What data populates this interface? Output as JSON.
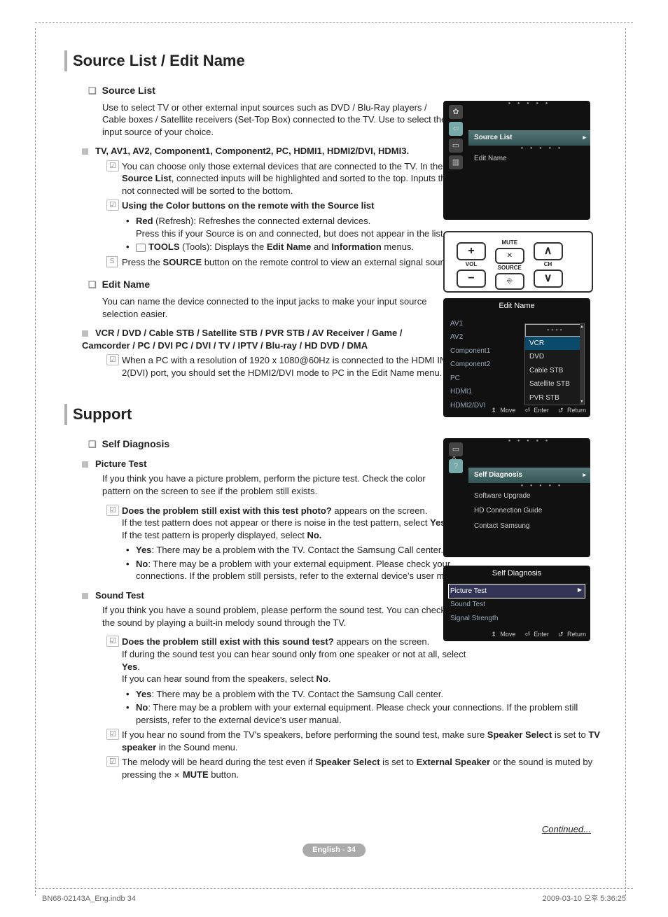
{
  "section1": {
    "title": "Source List / Edit Name",
    "source_list": {
      "heading": "Source List",
      "intro": "Use to select TV or other external input sources such as DVD / Blu-Ray players / Cable boxes / Satellite receivers (Set-Top Box) connected to the TV. Use to select the input source of your choice.",
      "inputs_heading": "TV, AV1, AV2, Component1, Component2, PC, HDMI1, HDMI2/DVI, HDMI3.",
      "note1_a": "You can choose only those external devices that are connected to the TV. In the ",
      "note1_b": "Source List",
      "note1_c": ", connected inputs will be highlighted and sorted to the top. Inputs that are not connected will be sorted to the bottom.",
      "note2_title": "Using the Color buttons on the remote with the Source list",
      "bullet_red_a": "Red",
      "bullet_red_b": " (Refresh): Refreshes the connected external devices.",
      "bullet_red_c": "Press this if your Source is on and connected, but does not appear in the list.",
      "bullet_tools_a": "TOOLS",
      "bullet_tools_b": " (Tools): Displays the ",
      "bullet_tools_c": "Edit Name",
      "bullet_tools_d": " and ",
      "bullet_tools_e": "Information",
      "bullet_tools_f": " menus.",
      "source_btn_a": "Press the ",
      "source_btn_b": "SOURCE",
      "source_btn_c": " button on the remote control to view an external signal source."
    },
    "edit_name": {
      "heading": "Edit Name",
      "intro": "You can name the device connected to the input jacks to make your input source selection easier.",
      "devices": "VCR / DVD / Cable STB / Satellite STB / PVR STB / AV Receiver / Game / Camcorder / PC / DVI PC / DVI / TV / IPTV / Blu-ray / HD DVD / DMA",
      "note": "When a PC with a resolution of 1920 x 1080@60Hz is connected to the HDMI IN 2(DVI) port, you should set the HDMI2/DVI mode to PC in the Edit Name menu."
    }
  },
  "section2": {
    "title": "Support",
    "self_diag": {
      "heading": "Self Diagnosis",
      "picture": {
        "h": "Picture Test",
        "intro": "If you think you have a picture problem, perform the picture test. Check the color pattern on the screen to see if the problem still exists.",
        "q_a": "Does the problem still exist with this test photo?",
        "q_b": " appears on the screen.",
        "line1_a": "If the test pattern does not appear or there is noise in the test pattern, select ",
        "line1_b": "Yes.",
        "line2_a": "If the test pattern is properly displayed, select ",
        "line2_b": "No.",
        "yes_a": "Yes",
        "yes_b": ": There may be a problem with the TV. Contact the Samsung Call center.",
        "no_a": "No",
        "no_b": ": There may be a problem with your external equipment. Please check your connections. If the problem still persists, refer to the external device's user manual."
      },
      "sound": {
        "h": "Sound Test",
        "intro": "If you think you have a sound problem, please perform the sound test. You can check the sound by playing a built-in melody sound through the TV.",
        "q_a": "Does the problem still exist with this sound test?",
        "q_b": " appears on the screen.",
        "line1_a": "If during the sound test you can hear sound only from one speaker or not at all, select ",
        "line1_b": "Yes",
        "line1_c": ".",
        "line2_a": "If you can hear sound from the speakers, select ",
        "line2_b": "No",
        "line2_c": ".",
        "yes_a": "Yes",
        "yes_b": ": There may be a problem with the TV. Contact the Samsung Call center.",
        "no_a": "No",
        "no_b": ": There may be a problem with your external equipment. Please check your connections. If the problem still persists, refer to the external device's user manual.",
        "note_spk_a": "If you hear no sound from the TV's speakers, before performing the sound test, make sure ",
        "note_spk_b": "Speaker Select",
        "note_spk_c": " is set to ",
        "note_spk_d": "TV speaker",
        "note_spk_e": " in the Sound menu.",
        "note_mute_a": "The melody will be heard during the test even if ",
        "note_mute_b": "Speaker Select",
        "note_mute_c": " is set to ",
        "note_mute_d": "External Speaker",
        "note_mute_e": " or the sound is muted by pressing the ",
        "note_mute_f": "MUTE",
        "note_mute_g": " button."
      }
    }
  },
  "osd_input": {
    "tab": "Input",
    "selected": "Source List",
    "item2": "Edit Name"
  },
  "remote": {
    "vol": "VOL",
    "mute": "MUTE",
    "source": "SOURCE",
    "ch": "CH",
    "plus": "+",
    "minus": "−"
  },
  "osd_editname": {
    "title": "Edit Name",
    "left": [
      "AV1",
      "AV2",
      "Component1",
      "Component2",
      "PC",
      "HDMI1",
      "HDMI2/DVI"
    ],
    "sel": "- - - -",
    "options": [
      "VCR",
      "DVD",
      "Cable STB",
      "Satellite STB",
      "PVR STB"
    ],
    "foot_move": "Move",
    "foot_enter": "Enter",
    "foot_return": "Return"
  },
  "osd_support": {
    "tab": "Support",
    "selected": "Self Diagnosis",
    "items": [
      "Software Upgrade",
      "HD Connection Guide",
      "Contact Samsung"
    ]
  },
  "osd_selfdiag": {
    "title": "Self Diagnosis",
    "sel": "Picture Test",
    "items": [
      "Sound Test",
      "Signal Strength"
    ],
    "foot_move": "Move",
    "foot_enter": "Enter",
    "foot_return": "Return"
  },
  "footer": {
    "continued": "Continued...",
    "page": "English - 34",
    "docnum": "BN68-02143A_Eng.indb   34",
    "date": "2009-03-10   오후 5:36:25"
  }
}
